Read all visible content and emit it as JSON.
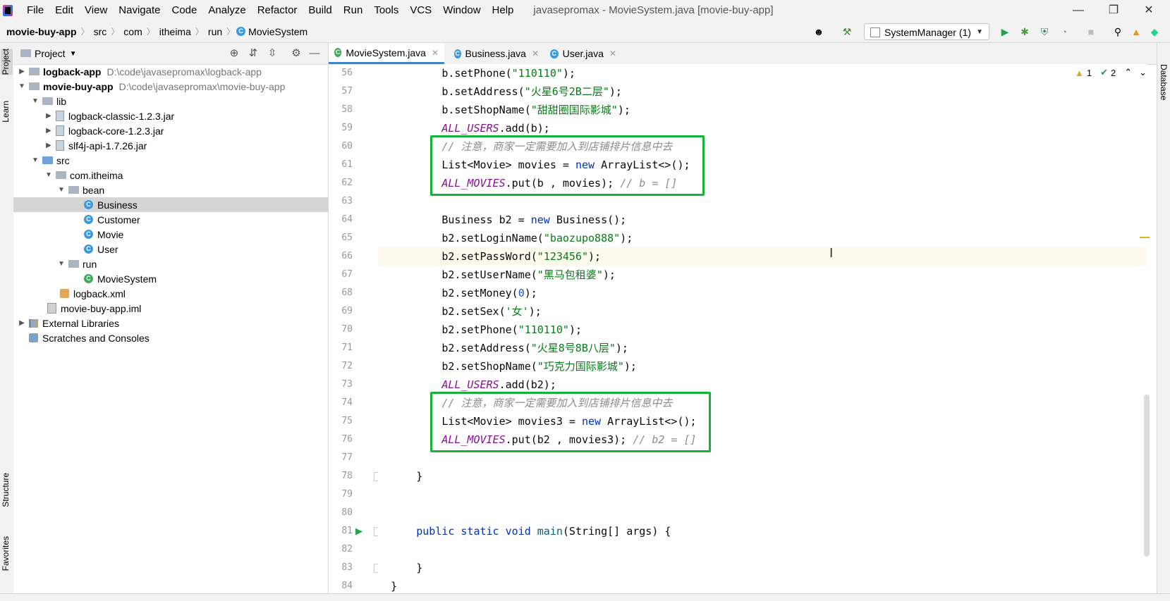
{
  "menu": {
    "items": [
      "File",
      "Edit",
      "View",
      "Navigate",
      "Code",
      "Analyze",
      "Refactor",
      "Build",
      "Run",
      "Tools",
      "VCS",
      "Window",
      "Help"
    ],
    "window_title": "javasepromax - MovieSystem.java [movie-buy-app]"
  },
  "navbar": {
    "breadcrumbs": [
      "movie-buy-app",
      "src",
      "com",
      "itheima",
      "run",
      "MovieSystem"
    ],
    "run_config": "SystemManager (1)"
  },
  "side_tabs": {
    "left_top": [
      "Project",
      "Learn"
    ],
    "left_bottom": [
      "Structure",
      "Favorites"
    ],
    "right": "Database"
  },
  "project": {
    "title": "Project",
    "tree": [
      {
        "label": "logback-app",
        "path": "D:\\code\\javasepromax\\logback-app",
        "bold": true
      },
      {
        "label": "movie-buy-app",
        "path": "D:\\code\\javasepromax\\movie-buy-app",
        "bold": true
      },
      {
        "label": "lib"
      },
      {
        "label": "logback-classic-1.2.3.jar"
      },
      {
        "label": "logback-core-1.2.3.jar"
      },
      {
        "label": "slf4j-api-1.7.26.jar"
      },
      {
        "label": "src"
      },
      {
        "label": "com.itheima"
      },
      {
        "label": "bean"
      },
      {
        "label": "Business"
      },
      {
        "label": "Customer"
      },
      {
        "label": "Movie"
      },
      {
        "label": "User"
      },
      {
        "label": "run"
      },
      {
        "label": "MovieSystem"
      },
      {
        "label": "logback.xml"
      },
      {
        "label": "movie-buy-app.iml"
      },
      {
        "label": "External Libraries"
      },
      {
        "label": "Scratches and Consoles"
      }
    ],
    "selected": "Business"
  },
  "editor": {
    "tabs": [
      "MovieSystem.java",
      "Business.java",
      "User.java"
    ],
    "active_tab": "MovieSystem.java",
    "inspection": {
      "warnings": "1",
      "ok": "2"
    },
    "line_numbers": [
      "56",
      "57",
      "58",
      "59",
      "60",
      "61",
      "62",
      "63",
      "64",
      "65",
      "66",
      "67",
      "68",
      "69",
      "70",
      "71",
      "72",
      "73",
      "74",
      "75",
      "76",
      "77",
      "78",
      "79",
      "80",
      "81",
      "82",
      "83",
      "84"
    ],
    "code": {
      "l56": [
        "b.setPhone(",
        "\"110110\"",
        ");"
      ],
      "l57": [
        "b.setAddress(",
        "\"火星6号2B二层\"",
        ");"
      ],
      "l58": [
        "b.setShopName(",
        "\"甜甜圈国际影城\"",
        ");"
      ],
      "l59": [
        "ALL_USERS",
        ".add(b);"
      ],
      "l60": [
        "// 注意，商家一定需要加入到店铺排片信息中去"
      ],
      "l61": [
        "List<Movie> movies = ",
        "new",
        " ArrayList<>();"
      ],
      "l62": [
        "ALL_MOVIES",
        ".put(b , movies); ",
        "// b = []"
      ],
      "l64": [
        "Business b2 = ",
        "new",
        " Business();"
      ],
      "l65": [
        "b2.setLoginName(",
        "\"baozupo888\"",
        ");"
      ],
      "l66": [
        "b2.setPassWord(",
        "\"123456\"",
        ");"
      ],
      "l67": [
        "b2.setUserName(",
        "\"黑马包租婆\"",
        ");"
      ],
      "l68": [
        "b2.setMoney(",
        "0",
        ");"
      ],
      "l69": [
        "b2.setSex(",
        "'女'",
        ");"
      ],
      "l70": [
        "b2.setPhone(",
        "\"110110\"",
        ");"
      ],
      "l71": [
        "b2.setAddress(",
        "\"火星8号8B八层\"",
        ");"
      ],
      "l72": [
        "b2.setShopName(",
        "\"巧克力国际影城\"",
        ");"
      ],
      "l73": [
        "ALL_USERS",
        ".add(b2);"
      ],
      "l74": [
        "// 注意，商家一定需要加入到店铺排片信息中去"
      ],
      "l75": [
        "List<Movie> movies3 = ",
        "new",
        " ArrayList<>();"
      ],
      "l76": [
        "ALL_MOVIES",
        ".put(b2 , movies3); ",
        "// b2 = []"
      ],
      "l78": [
        "}"
      ],
      "l81": [
        "public",
        " ",
        "static",
        " ",
        "void",
        " ",
        "main",
        "(String[] args) {"
      ],
      "l83": [
        "}"
      ],
      "l84": [
        "}"
      ]
    }
  },
  "colors": {
    "highlight_box": "#16b33a",
    "keyword": "#0033b3",
    "string": "#067d17",
    "constant": "#871094",
    "comment": "#8c8c8c"
  }
}
